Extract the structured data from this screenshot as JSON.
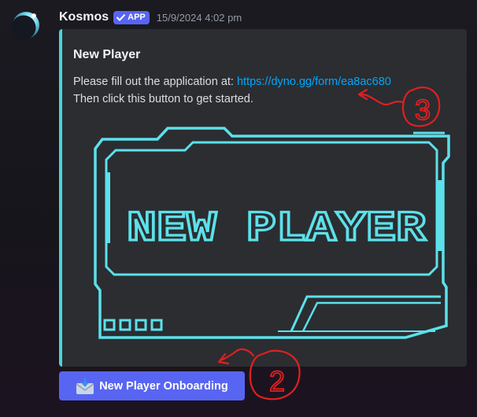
{
  "message": {
    "author": "Kosmos",
    "app_badge": "APP",
    "timestamp": "15/9/2024 4:02 pm",
    "avatar_icon": "eclipse-planet-icon"
  },
  "embed": {
    "accent_color": "#48d5dc",
    "title": "New Player",
    "description_line1_prefix": "Please fill out the application at: ",
    "link_text": "https://dyno.gg/form/ea8ac680",
    "description_line2": "Then click this button to get started.",
    "image_text": "NEW PLAYER",
    "image_color": "#5ce1ea"
  },
  "button": {
    "label": "New Player Onboarding",
    "icon": "envelope-inbox-icon",
    "color": "#5865f2"
  },
  "annotations": {
    "marker_3": "3",
    "marker_2": "2",
    "color": "#e02020"
  }
}
